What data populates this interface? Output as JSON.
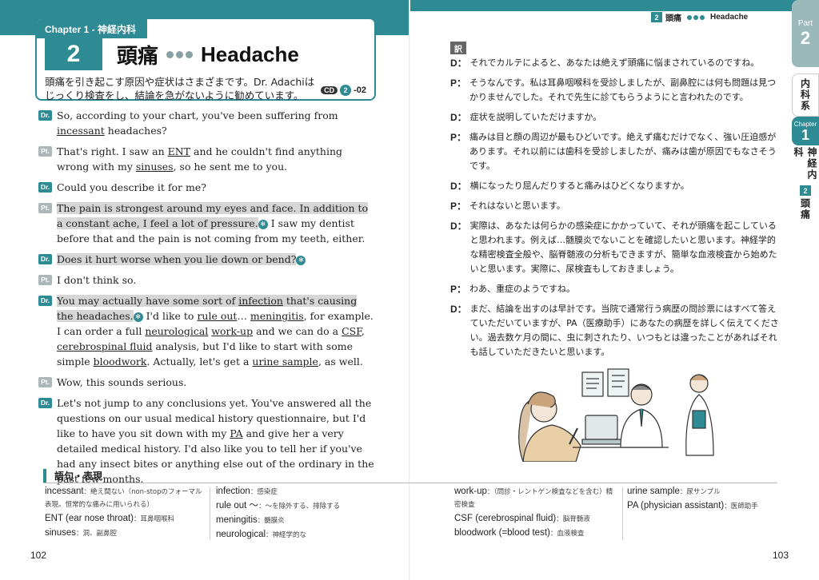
{
  "colors": {
    "teal": "#2e8a93",
    "highlight": "#d6d6d6"
  },
  "header": {
    "chapter_label": "Chapter 1 - 神経内科",
    "number": "2",
    "title_ja": "頭痛",
    "title_en": "Headache",
    "intro": "頭痛を引き起こす原因や症状はさまざまです。Dr. Adachiはじっくり検査をし、結論を急がないように勧めています。",
    "cd": {
      "label": "CD",
      "disc": "2",
      "track": "-02"
    }
  },
  "speaker_tags": {
    "dr": "Dr.",
    "pt": "Pt."
  },
  "audio_icon": "sound-icon",
  "dialogue": [
    {
      "speaker": "dr",
      "segments": [
        {
          "t": "So, according to your chart, you've been suffering from "
        },
        {
          "t": "incessant",
          "u": true
        },
        {
          "t": " headaches?"
        }
      ]
    },
    {
      "speaker": "pt",
      "segments": [
        {
          "t": "That's right. I saw an "
        },
        {
          "t": "ENT",
          "u": true
        },
        {
          "t": " and he couldn't find anything wrong with my "
        },
        {
          "t": "sinuses",
          "u": true
        },
        {
          "t": ", so he sent me to you."
        }
      ]
    },
    {
      "speaker": "dr",
      "segments": [
        {
          "t": "Could you describe it for me?"
        }
      ]
    },
    {
      "speaker": "pt",
      "segments": [
        {
          "t": "The pain is strongest around my eyes and face. In addition to a constant ache, I feel a lot of pressure.",
          "hl": true
        },
        {
          "icon": true
        },
        {
          "t": " I saw my dentist before that and the pain is not coming from my teeth, either."
        }
      ]
    },
    {
      "speaker": "dr",
      "segments": [
        {
          "t": "Does it hurt worse when you lie down or bend?",
          "hl": true
        },
        {
          "icon": true
        }
      ]
    },
    {
      "speaker": "pt",
      "segments": [
        {
          "t": "I don't think so."
        }
      ]
    },
    {
      "speaker": "dr",
      "segments": [
        {
          "t": "You may actually have some sort of ",
          "hl": true
        },
        {
          "t": "infection",
          "u": true,
          "hl": true
        },
        {
          "t": " that's causing the headaches.",
          "hl": true
        },
        {
          "icon": true
        },
        {
          "t": " I'd like to "
        },
        {
          "t": "rule out",
          "u": true
        },
        {
          "t": "… "
        },
        {
          "t": "meningitis",
          "u": true
        },
        {
          "t": ", for example. I can order a full "
        },
        {
          "t": "neurological",
          "u": true
        },
        {
          "t": " "
        },
        {
          "t": "work-up",
          "u": true
        },
        {
          "t": " and we can do a "
        },
        {
          "t": "CSF",
          "u": true
        },
        {
          "t": ", "
        },
        {
          "t": "cerebrospinal fluid",
          "u": true
        },
        {
          "t": " analysis, but I'd like to start with some simple "
        },
        {
          "t": "bloodwork",
          "u": true
        },
        {
          "t": ". Actually, let's get a "
        },
        {
          "t": "urine sample",
          "u": true
        },
        {
          "t": ", as well."
        }
      ]
    },
    {
      "speaker": "pt",
      "segments": [
        {
          "t": "Wow, this sounds serious."
        }
      ]
    },
    {
      "speaker": "dr",
      "segments": [
        {
          "t": "Let's not jump to any conclusions yet. You've answered all the questions on our usual medical history questionnaire, but I'd like to have you sit down with my "
        },
        {
          "t": "PA",
          "u": true
        },
        {
          "t": " and give her a very detailed medical history. I'd also like you to tell her if you've had any insect bites or anything else out of the ordinary in the past few months."
        }
      ]
    }
  ],
  "glossary": {
    "title": "語句・表現",
    "columns": [
      [
        {
          "term": "incessant",
          "def": "：絶え間ない（non-stopのフォーマル表現。恒常的な痛みに用いられる）"
        },
        {
          "term": "ENT (ear nose throat)",
          "def": "：耳鼻咽喉科"
        },
        {
          "term": "sinuses",
          "def": "：洞、副鼻腔"
        }
      ],
      [
        {
          "term": "infection",
          "def": "：感染症"
        },
        {
          "term": "rule out ～",
          "def": "：～を除外する、排除する"
        },
        {
          "term": "meningitis",
          "def": "：髄膜炎"
        },
        {
          "term": "neurological",
          "def": "：神経学的な"
        }
      ],
      [
        {
          "term": "work-up",
          "def": "：（問診・レントゲン検査などを含む）精密検査"
        },
        {
          "term": "CSF (cerebrospinal fluid)",
          "def": "：脳脊髄液"
        },
        {
          "term": "bloodwork (=blood test)",
          "def": "：血液検査"
        }
      ],
      [
        {
          "term": "urine sample",
          "def": "：尿サンプル"
        },
        {
          "term": "PA (physician assistant)",
          "def": "：医師助手"
        }
      ]
    ]
  },
  "page_left": "102",
  "page_right": "103",
  "right_header": {
    "number": "2",
    "title_ja": "頭痛",
    "title_en": "Headache"
  },
  "translation_label": "訳",
  "translation": [
    {
      "sp": "D",
      "text": "それでカルテによると、あなたは絶えず頭痛に悩まされているのですね。"
    },
    {
      "sp": "P",
      "text": "そうなんです。私は耳鼻咽喉科を受診しましたが、副鼻腔には何も問題は見つかりませんでした。それで先生に診てもらうようにと言われたのです。"
    },
    {
      "sp": "D",
      "text": "症状を説明していただけますか。"
    },
    {
      "sp": "P",
      "text": "痛みは目と顔の周辺が最もひどいです。絶えず痛むだけでなく、強い圧迫感があります。それ以前には歯科を受診しましたが、痛みは歯が原因でもなさそうです。"
    },
    {
      "sp": "D",
      "text": "横になったり屈んだりすると痛みはひどくなりますか。"
    },
    {
      "sp": "P",
      "text": "それはないと思います。"
    },
    {
      "sp": "D",
      "text": "実際は、あなたは何らかの感染症にかかっていて、それが頭痛を起こしていると思われます。例えば…髄膜炎でないことを確認したいと思います。神経学的な精密検査全般や、脳脊髄液の分析もできますが、簡単な血液検査から始めたいと思います。実際に、尿検査もしておきましょう。"
    },
    {
      "sp": "P",
      "text": "わあ、重症のようですね。"
    },
    {
      "sp": "D",
      "text": "まだ、結論を出すのは早計です。当院で通常行う病歴の問診票にはすべて答えていただいていますが、PA（医療助手）にあなたの病歴を詳しく伝えてください。過去数ケ月の間に、虫に刺されたり、いつもとは違ったことがあればそれも話していただきたいと思います。"
    }
  ],
  "side": {
    "part_small": "Part",
    "part_num": "2",
    "section": "内科系",
    "chapter_small": "Chapter",
    "chapter_num": "1",
    "chapter_title": "神経内科",
    "topic_num": "2",
    "topic": "頭痛"
  }
}
